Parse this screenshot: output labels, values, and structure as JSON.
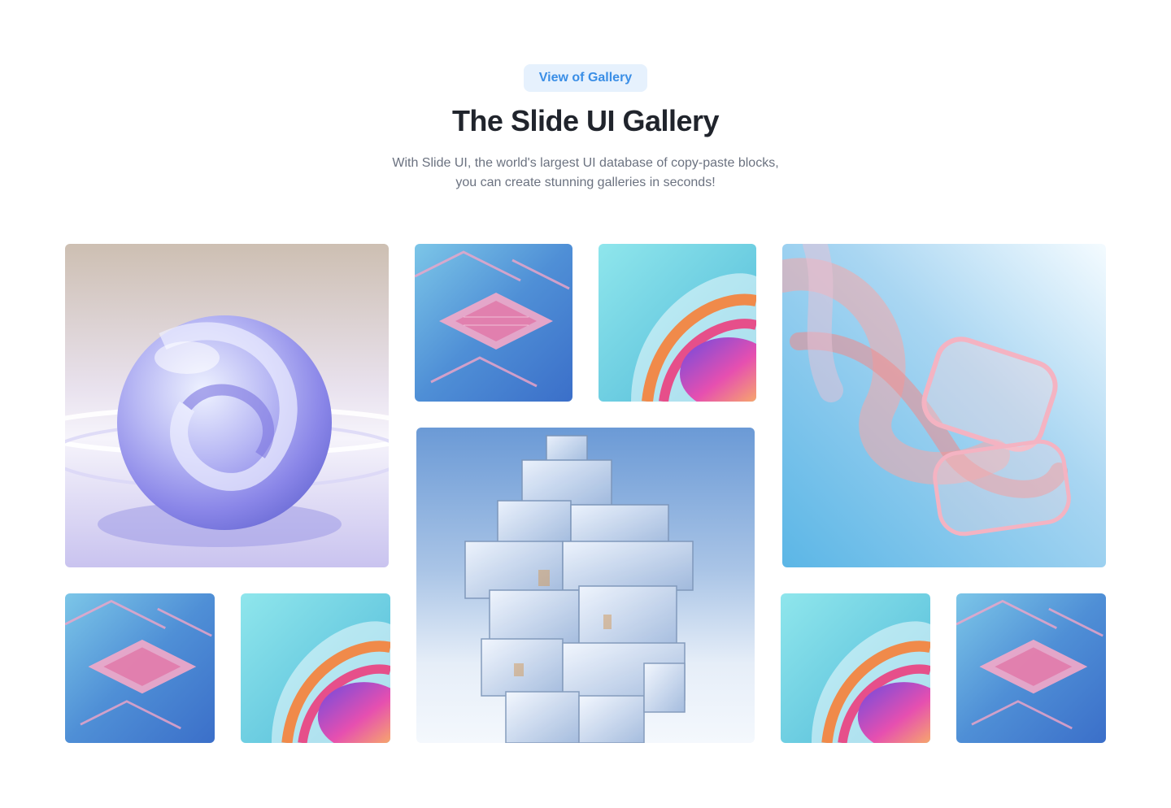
{
  "header": {
    "badge": "View of Gallery",
    "title": "The Slide UI Gallery",
    "subtitle_line1": "With Slide UI, the world's largest UI database of copy-paste blocks,",
    "subtitle_line2": "you can create stunning galleries in seconds!"
  },
  "gallery": {
    "images": [
      {
        "name": "glass-sphere"
      },
      {
        "name": "chip-circuit"
      },
      {
        "name": "rainbow-swirl"
      },
      {
        "name": "pink-glass-ribbons"
      },
      {
        "name": "glass-cube-tower"
      },
      {
        "name": "chip-circuit"
      },
      {
        "name": "rainbow-swirl"
      },
      {
        "name": "rainbow-swirl"
      },
      {
        "name": "chip-circuit"
      }
    ]
  },
  "colors": {
    "badge_bg": "#e6f1fd",
    "badge_text": "#3a8ee6",
    "title": "#20242c",
    "subtitle": "#6b7280"
  }
}
